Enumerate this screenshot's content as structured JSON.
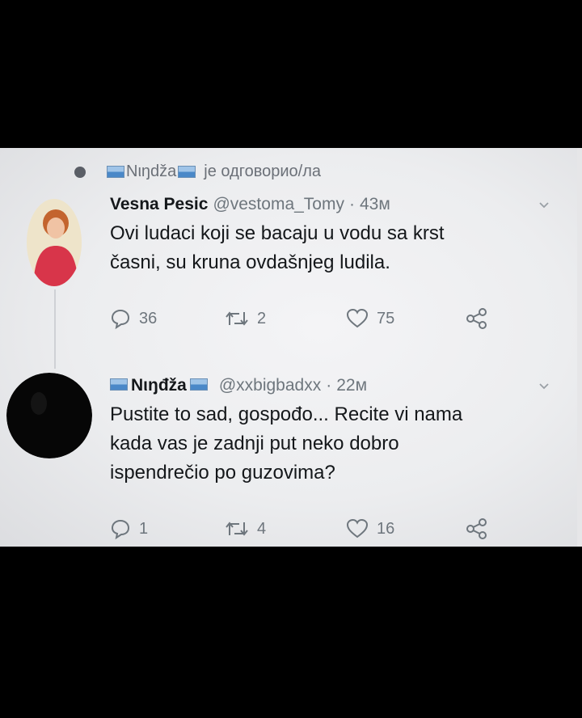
{
  "context": {
    "replier_name": "Nιŋdža",
    "reply_text": "je одговорио/ла"
  },
  "tweets": [
    {
      "name": "Vesna Pesic",
      "handle": "@vestoma_Tomy",
      "time": "43м",
      "text_lines": [
        "Ovi ludaci koji se bacaju u vodu sa krst",
        "časni, su kruna ovdašnjeg ludila."
      ],
      "replies": "36",
      "retweets": "2",
      "likes": "75"
    },
    {
      "name": "Nιŋđža",
      "handle": "@xxbigbadxx",
      "time": "22м",
      "text_lines": [
        "Pustite to sad, gospođo... Recite vi nama",
        "kada vas je zadnji put neko dobro",
        "ispendrečio po guzovima?"
      ],
      "replies": "1",
      "retweets": "4",
      "likes": "16"
    }
  ],
  "icons": {
    "reply": "reply-icon",
    "retweet": "retweet-icon",
    "like": "heart-icon",
    "share": "share-icon",
    "more": "chevron-down-icon"
  },
  "colors": {
    "background": "#000000",
    "card": "#eeeff1",
    "text": "#14171a",
    "muted": "#6e767d"
  }
}
